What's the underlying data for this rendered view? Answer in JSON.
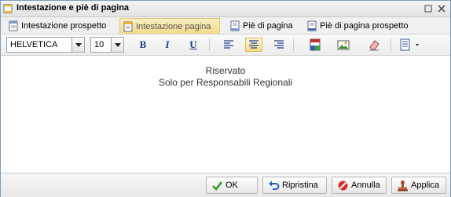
{
  "dialog": {
    "title": "Intestazione e piè di pagina",
    "icons": {
      "title": "header-footer-icon",
      "restore": "restore-window-icon",
      "close": "close-icon"
    }
  },
  "tabs": [
    {
      "label": "Intestazione prospetto",
      "icon": "report-header-icon",
      "active": false
    },
    {
      "label": "Intestazione pagina",
      "icon": "page-header-icon",
      "active": true
    },
    {
      "label": "Piè di pagina",
      "icon": "page-footer-icon",
      "active": false
    },
    {
      "label": "Piè di pagina prospetto",
      "icon": "report-footer-icon",
      "active": false
    }
  ],
  "toolbar": {
    "font_family": "HELVETICA",
    "font_size": "10",
    "bold": "B",
    "italic": "I",
    "underline": "U",
    "alignment": "center",
    "icons": [
      "align-left-icon",
      "align-center-icon",
      "align-right-icon",
      "background-color-icon",
      "insert-image-icon",
      "clear-format-icon",
      "insert-field-icon"
    ]
  },
  "content": {
    "lines": [
      "Riservato",
      "Solo per Responsabili Regionali"
    ]
  },
  "footer": {
    "ok_label": "OK",
    "reset_label": "Ripristina",
    "cancel_label": "Annulla",
    "apply_label": "Applica"
  },
  "colors": {
    "active_tab": "#f3d98a",
    "border": "#7f9db9",
    "text": "#333333"
  }
}
